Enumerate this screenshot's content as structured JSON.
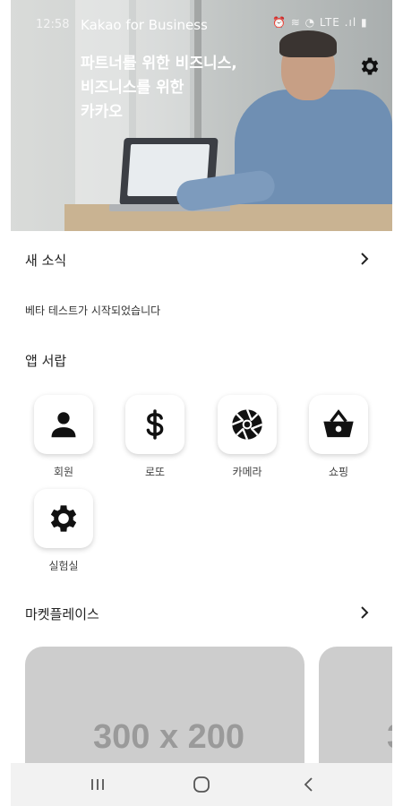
{
  "status_bar": {
    "time": "12:58",
    "icons": "⏰ ≋ ◔ LTE .ıl ▮"
  },
  "header": {
    "app_title": "Kakao for Business",
    "headline": "파트너를 위한 비즈니스,\n비즈니스를 위한\n카카오",
    "settings_icon": "gear-icon"
  },
  "news": {
    "title": "새 소식",
    "item": "베타 테스트가 시작되었습니다"
  },
  "app_drawer": {
    "title": "앱 서랍",
    "apps": [
      {
        "label": "회원",
        "icon": "person-icon"
      },
      {
        "label": "로또",
        "icon": "dollar-icon"
      },
      {
        "label": "카메라",
        "icon": "aperture-icon"
      },
      {
        "label": "쇼핑",
        "icon": "shopping-basket-icon"
      },
      {
        "label": "실험실",
        "icon": "gear-icon"
      }
    ]
  },
  "marketplace": {
    "title": "마켓플레이스",
    "cards": [
      {
        "placeholder": "300 x 200"
      },
      {
        "placeholder": "3"
      }
    ]
  },
  "colors": {
    "card_bg": "#cdcdcd",
    "card_text": "#9a9a9a",
    "nav_bg": "#f2f2f2"
  }
}
